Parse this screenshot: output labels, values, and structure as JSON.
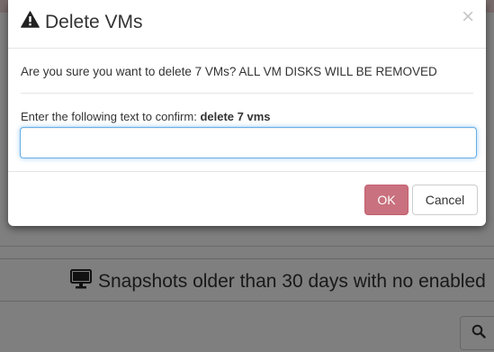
{
  "dialog": {
    "title": "Delete VMs",
    "close_symbol": "×",
    "message": "Are you sure you want to delete 7 VMs? ALL VM DISKS WILL BE REMOVED",
    "confirm_prompt": "Enter the following text to confirm: ",
    "confirm_phrase": "delete 7 vms",
    "input_value": "",
    "ok_label": "OK",
    "cancel_label": "Cancel",
    "title_icon": "warning-icon",
    "ok_color": "#c9717e",
    "focus_color": "#66afe9"
  },
  "background": {
    "section_title": "Snapshots older than 30 days with no enabled",
    "section_icon": "monitor-icon",
    "search_icon": "search-icon"
  }
}
